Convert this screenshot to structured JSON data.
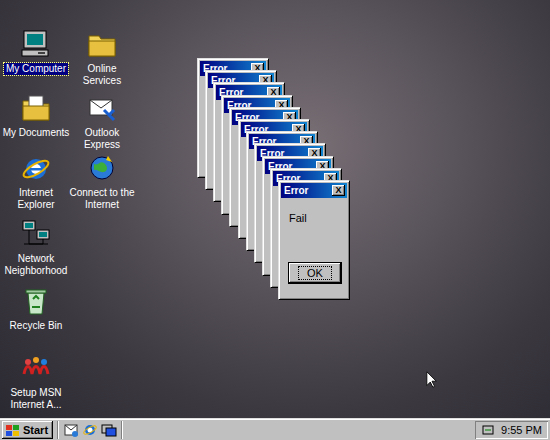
{
  "desktop_icons": [
    {
      "label": "My Computer",
      "kind": "computer",
      "selected": true
    },
    {
      "label": "My Documents",
      "kind": "documents",
      "selected": false
    },
    {
      "label": "Internet Explorer",
      "kind": "ie",
      "selected": false
    },
    {
      "label": "Network Neighborhood",
      "kind": "network",
      "selected": false
    },
    {
      "label": "Recycle Bin",
      "kind": "recycle",
      "selected": false
    },
    {
      "label": "Setup MSN Internet A...",
      "kind": "msn",
      "selected": false
    },
    {
      "label": "Online Services",
      "kind": "folder",
      "selected": false
    },
    {
      "label": "Outlook Express",
      "kind": "outlook",
      "selected": false
    },
    {
      "label": "Connect to the Internet",
      "kind": "connect",
      "selected": false
    }
  ],
  "dialogs": [
    {
      "title": "Error",
      "close": "X"
    },
    {
      "title": "Error",
      "close": "X"
    },
    {
      "title": "Error",
      "close": "X"
    },
    {
      "title": "Error",
      "close": "X"
    },
    {
      "title": "Error",
      "close": "X"
    },
    {
      "title": "Error",
      "close": "X"
    },
    {
      "title": "Error",
      "close": "X"
    },
    {
      "title": "Error",
      "close": "X"
    },
    {
      "title": "Error",
      "close": "X"
    },
    {
      "title": "Error",
      "close": "X"
    }
  ],
  "front_dialog": {
    "title": "Error",
    "close": "X",
    "message": "Fail",
    "button": "OK"
  },
  "taskbar": {
    "start": "Start",
    "clock": "9:55 PM"
  }
}
